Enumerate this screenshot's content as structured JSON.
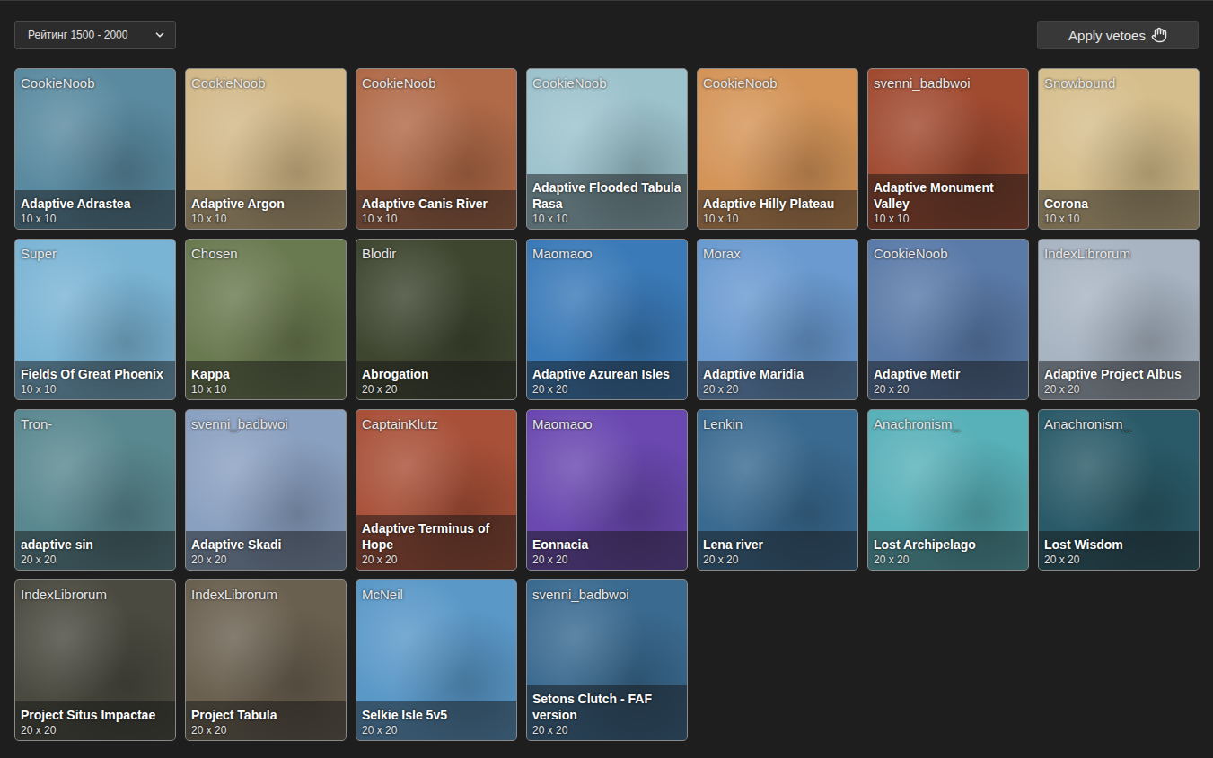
{
  "filter": {
    "label": "Рейтинг 1500 - 2000"
  },
  "apply_button": {
    "label": "Apply vetoes"
  },
  "maps": [
    {
      "author": "CookieNoob",
      "name": "Adaptive Adrastea",
      "size": "10 x 10",
      "color": "#5a8aa0"
    },
    {
      "author": "CookieNoob",
      "name": "Adaptive Argon",
      "size": "10 x 10",
      "color": "#d2b888"
    },
    {
      "author": "CookieNoob",
      "name": "Adaptive Canis River",
      "size": "10 x 10",
      "color": "#b06a48"
    },
    {
      "author": "CookieNoob",
      "name": "Adaptive Flooded Tabula Rasa",
      "size": "10 x 10",
      "color": "#9cc2cc"
    },
    {
      "author": "CookieNoob",
      "name": "Adaptive Hilly Plateau",
      "size": "10 x 10",
      "color": "#d49458"
    },
    {
      "author": "svenni_badbwoi",
      "name": "Adaptive Monument Valley",
      "size": "10 x 10",
      "color": "#a04a30"
    },
    {
      "author": "Snowbound",
      "name": "Corona",
      "size": "10 x 10",
      "color": "#d6be8c"
    },
    {
      "author": "Super",
      "name": "Fields Of Great Phoenix",
      "size": "10 x 10",
      "color": "#7ab4d4"
    },
    {
      "author": "Chosen",
      "name": "Kappa",
      "size": "10 x 10",
      "color": "#6a7a50"
    },
    {
      "author": "Blodir",
      "name": "Abrogation",
      "size": "20 x 20",
      "color": "#3e4630"
    },
    {
      "author": "Maomaoo",
      "name": "Adaptive Azurean Isles",
      "size": "20 x 20",
      "color": "#3a7ab8"
    },
    {
      "author": "Morax",
      "name": "Adaptive Maridia",
      "size": "20 x 20",
      "color": "#6a9ad0"
    },
    {
      "author": "CookieNoob",
      "name": "Adaptive Metir",
      "size": "20 x 20",
      "color": "#5a7aa8"
    },
    {
      "author": "IndexLibrorum",
      "name": "Adaptive Project Albus",
      "size": "20 x 20",
      "color": "#a8b4c2"
    },
    {
      "author": "Tron-",
      "name": "adaptive sin",
      "size": "20 x 20",
      "color": "#5a8890"
    },
    {
      "author": "svenni_badbwoi",
      "name": "Adaptive Skadi",
      "size": "20 x 20",
      "color": "#8aa0c0"
    },
    {
      "author": "CaptainKlutz",
      "name": "Adaptive Terminus of Hope",
      "size": "20 x 20",
      "color": "#a85038"
    },
    {
      "author": "Maomaoo",
      "name": "Eonnacia",
      "size": "20 x 20",
      "color": "#6a48b0"
    },
    {
      "author": "Lenkin",
      "name": "Lena river",
      "size": "20 x 20",
      "color": "#3a6a90"
    },
    {
      "author": "Anachronism_",
      "name": "Lost Archipelago",
      "size": "20 x 20",
      "color": "#58b0b8"
    },
    {
      "author": "Anachronism_",
      "name": "Lost Wisdom",
      "size": "20 x 20",
      "color": "#2a5a68"
    },
    {
      "author": "IndexLibrorum",
      "name": "Project Situs Impactae",
      "size": "20 x 20",
      "color": "#4a4a40"
    },
    {
      "author": "IndexLibrorum",
      "name": "Project Tabula",
      "size": "20 x 20",
      "color": "#6a6050"
    },
    {
      "author": "McNeil",
      "name": "Selkie Isle 5v5",
      "size": "20 x 20",
      "color": "#5a98c8"
    },
    {
      "author": "svenni_badbwoi",
      "name": "Setons Clutch - FAF version",
      "size": "20 x 20",
      "color": "#3a6a90"
    }
  ]
}
